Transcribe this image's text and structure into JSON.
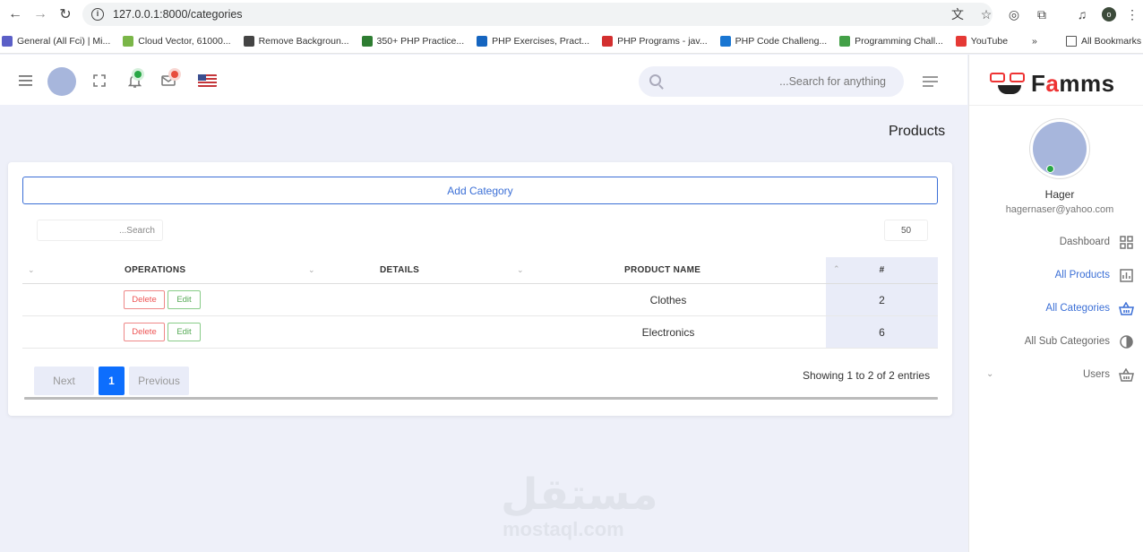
{
  "browser": {
    "url": "127.0.0.1:8000/categories",
    "bookmarks": [
      {
        "label": "General (All Fci) | Mi...",
        "color": "#5b5fc7"
      },
      {
        "label": "Cloud Vector, 61000...",
        "color": "#7ab648"
      },
      {
        "label": "Remove Backgroun...",
        "color": "#444"
      },
      {
        "label": "350+ PHP Practice...",
        "color": "#2e7d32"
      },
      {
        "label": "PHP Exercises, Pract...",
        "color": "#1565c0"
      },
      {
        "label": "PHP Programs - jav...",
        "color": "#d32f2f"
      },
      {
        "label": "PHP Code Challeng...",
        "color": "#1976d2"
      },
      {
        "label": "Programming Chall...",
        "color": "#43a047"
      },
      {
        "label": "YouTube",
        "color": "#e53935"
      }
    ],
    "more": "»",
    "all_bookmarks": "All Bookmarks",
    "profile_initial": "o"
  },
  "header": {
    "search_placeholder": "...Search for anything"
  },
  "sidebar": {
    "logo_pre": "F",
    "logo_accent": "a",
    "logo_post": "mms",
    "user_name": "Hager",
    "user_email": "hagernaser@yahoo.com",
    "items": [
      {
        "label": "Dashboard",
        "icon": "dashboard-icon"
      },
      {
        "label": "All Products",
        "icon": "chart-icon"
      },
      {
        "label": "All Categories",
        "icon": "basket-icon"
      },
      {
        "label": "All Sub Categories",
        "icon": "contrast-icon"
      },
      {
        "label": "Users",
        "icon": "basket-icon"
      }
    ]
  },
  "main": {
    "page_title": "Products",
    "add_button": "Add Category",
    "table_search_placeholder": "...Search",
    "page_size": "50",
    "columns": {
      "operations": "OPERATIONS",
      "details": "DETAILS",
      "product_name": "PRODUCT NAME",
      "number": "#"
    },
    "rows": [
      {
        "delete": "Delete",
        "edit": "Edit",
        "details": "",
        "name": "Clothes",
        "number": "2"
      },
      {
        "delete": "Delete",
        "edit": "Edit",
        "details": "",
        "name": "Electronics",
        "number": "6"
      }
    ],
    "pager": {
      "next": "Next",
      "current": "1",
      "previous": "Previous"
    },
    "showing": "Showing 1 to 2 of 2 entries"
  },
  "watermark": {
    "arabic": "مستقل",
    "latin": "mostaql.com"
  }
}
